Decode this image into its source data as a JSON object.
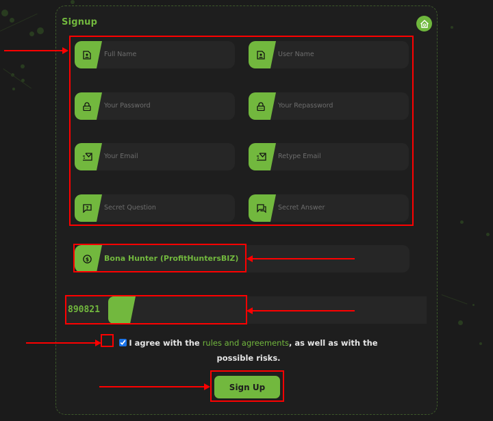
{
  "form": {
    "title": "Signup",
    "home_icon": "home-icon",
    "fields": [
      {
        "placeholder": "Full Name",
        "icon": "id-card-icon"
      },
      {
        "placeholder": "User Name",
        "icon": "id-card-icon"
      },
      {
        "placeholder": "Your Password",
        "icon": "lock-icon"
      },
      {
        "placeholder": "Your Repassword",
        "icon": "lock-icon"
      },
      {
        "placeholder": "Your Email",
        "icon": "mail-fast-icon"
      },
      {
        "placeholder": "Retype Email",
        "icon": "mail-fast-icon"
      },
      {
        "placeholder": "Secret Question",
        "icon": "question-bubble-icon"
      },
      {
        "placeholder": "Secret Answer",
        "icon": "chat-bubbles-icon"
      }
    ],
    "sponsor": {
      "value": "Bona Hunter (ProfitHuntersBIZ)",
      "icon": "dollar-coin-icon"
    },
    "captcha": {
      "code": "890821",
      "value": ""
    },
    "agreement": {
      "checked": true,
      "text_before": "I agree with the ",
      "link": "rules and agreements",
      "text_after": ", as well as with the possible risks."
    },
    "submit_label": "Sign Up"
  },
  "colors": {
    "accent": "#72b83e",
    "annotation": "#ff0000",
    "background": "#1b1b1b",
    "field_bg": "#262626"
  }
}
